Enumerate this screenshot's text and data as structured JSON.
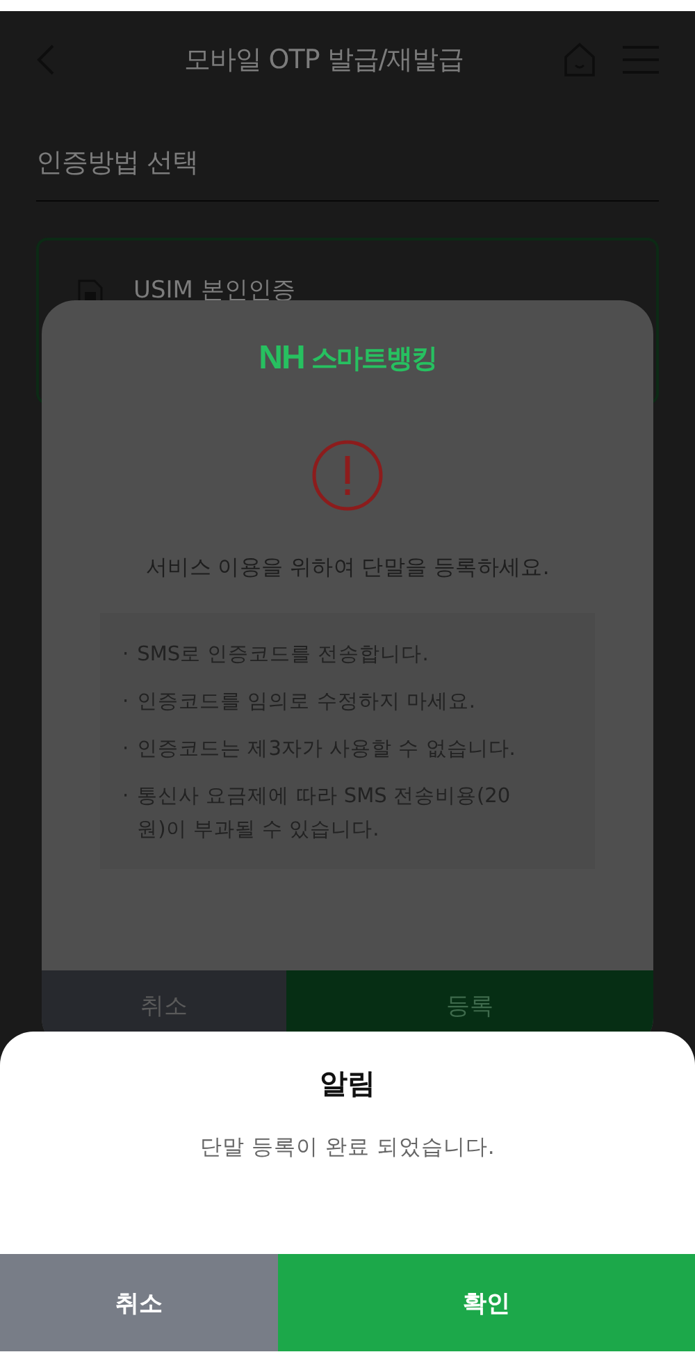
{
  "header": {
    "title": "모바일 OTP 발급/재발급"
  },
  "section": {
    "title": "인증방법 선택"
  },
  "card": {
    "label": "USIM 본인인증"
  },
  "modal": {
    "logo_mark": "NH",
    "logo_text": "스마트뱅킹",
    "message": "서비스 이용을 위하여 단말을 등록하세요.",
    "bullet": "·",
    "notes": [
      "SMS로 인증코드를 전송합니다.",
      "인증코드를 임의로 수정하지 마세요.",
      "인증코드는 제3자가 사용할 수 없습니다.",
      "통신사 요금제에 따라 SMS 전송비용(20원)이 부과될 수 있습니다."
    ],
    "buttons": [
      {
        "label": "취소",
        "kind": "cancel"
      },
      {
        "label": "등록",
        "kind": "confirm"
      }
    ]
  },
  "alert": {
    "title": "알림",
    "message": "단말 등록이 완료 되었습니다.",
    "buttons": [
      {
        "label": "취소",
        "kind": "cancel"
      },
      {
        "label": "확인",
        "kind": "confirm"
      }
    ]
  }
}
